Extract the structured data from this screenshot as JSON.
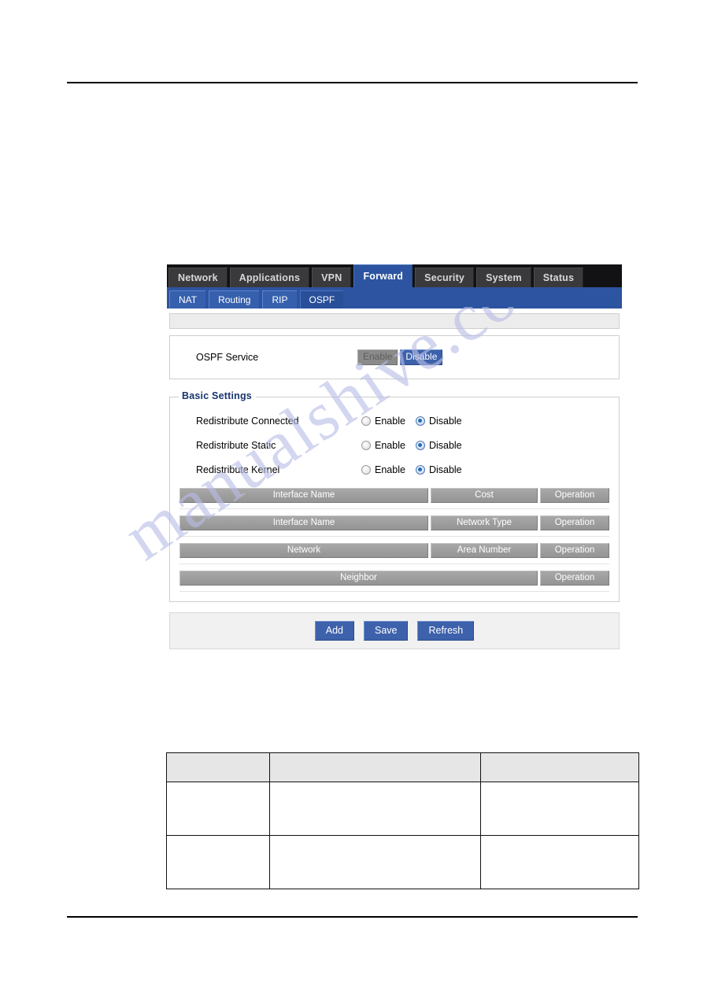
{
  "page": {
    "background_color": "#ffffff",
    "rule_color": "#000000"
  },
  "watermark": {
    "text": "manualshive.com",
    "color": "#b9bde6"
  },
  "router_ui": {
    "main_tabs": [
      {
        "label": "Network",
        "active": false
      },
      {
        "label": "Applications",
        "active": false
      },
      {
        "label": "VPN",
        "active": false
      },
      {
        "label": "Forward",
        "active": true
      },
      {
        "label": "Security",
        "active": false
      },
      {
        "label": "System",
        "active": false
      },
      {
        "label": "Status",
        "active": false
      }
    ],
    "sub_tabs": [
      {
        "label": "NAT",
        "active": false
      },
      {
        "label": "Routing",
        "active": false
      },
      {
        "label": "RIP",
        "active": false
      },
      {
        "label": "OSPF",
        "active": true
      }
    ],
    "service_panel": {
      "label": "OSPF Service",
      "enable_label": "Enable",
      "disable_label": "Disable",
      "selected": "Disable"
    },
    "basic_settings": {
      "legend": "Basic Settings",
      "rows": [
        {
          "label": "Redistribute Connected",
          "enable_label": "Enable",
          "disable_label": "Disable",
          "selected": "Disable"
        },
        {
          "label": "Redistribute Static",
          "enable_label": "Enable",
          "disable_label": "Disable",
          "selected": "Disable"
        },
        {
          "label": "Redistribute Kernel",
          "enable_label": "Enable",
          "disable_label": "Disable",
          "selected": "Disable"
        }
      ],
      "header_bars": [
        {
          "columns": [
            "Interface Name",
            "Cost",
            "Operation"
          ]
        },
        {
          "columns": [
            "Interface Name",
            "Network Type",
            "Operation"
          ]
        },
        {
          "columns": [
            "Network",
            "Area Number",
            "Operation"
          ]
        },
        {
          "columns": [
            "Neighbor",
            "Operation"
          ]
        }
      ]
    },
    "actions": {
      "add_label": "Add",
      "save_label": "Save",
      "refresh_label": "Refresh"
    },
    "accent_colors": {
      "tab_active": "#2d54a0",
      "tabbar_bg": "#121214",
      "button_blue": "#3d62ab",
      "header_bar_gray": "#9a9a9a",
      "legend_navy": "#17356e"
    }
  },
  "doc_table": {
    "header": [
      "",
      "",
      ""
    ],
    "rows": [
      [
        "",
        "",
        ""
      ],
      [
        "",
        "",
        ""
      ]
    ]
  }
}
